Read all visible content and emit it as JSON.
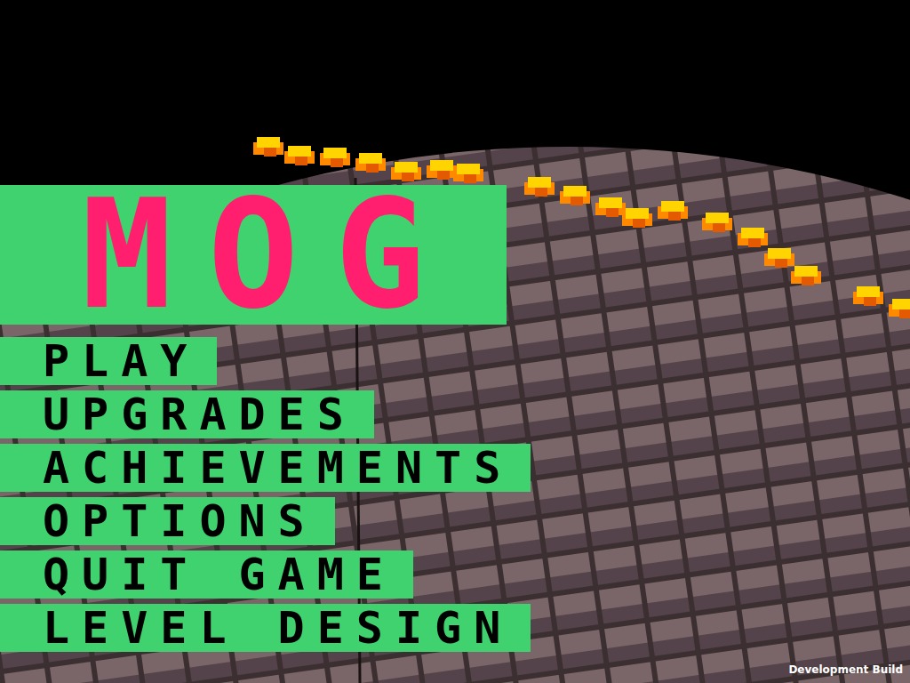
{
  "logo": {
    "title": "MOG"
  },
  "menu": [
    {
      "label": "PLAY"
    },
    {
      "label": "UPGRADES"
    },
    {
      "label": "ACHIEVEMENTS"
    },
    {
      "label": "OPTIONS"
    },
    {
      "label": "QUIT GAME"
    },
    {
      "label": "LEVEL DESIGN"
    }
  ],
  "build_label": "Development Build"
}
